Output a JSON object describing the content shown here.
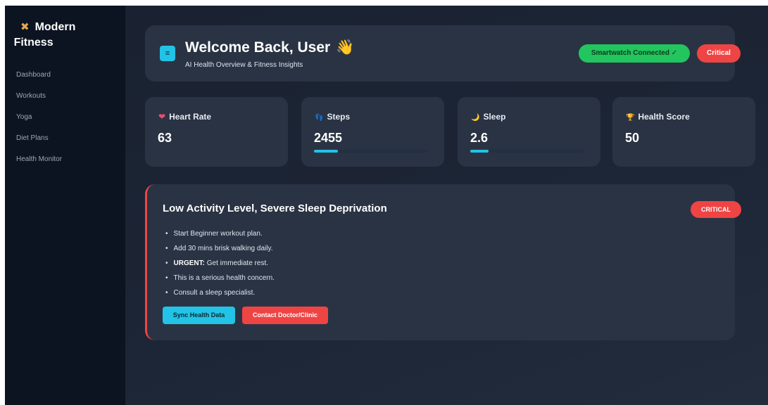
{
  "brand": {
    "icon": "dumbbell-icon",
    "line1": "Modern",
    "line2": "Fitness"
  },
  "nav": [
    {
      "label": "Dashboard"
    },
    {
      "label": "Workouts"
    },
    {
      "label": "Yoga"
    },
    {
      "label": "Diet Plans"
    },
    {
      "label": "Health Monitor"
    }
  ],
  "header": {
    "title": "Welcome Back, User",
    "wave": "👋",
    "subtitle": "AI Health Overview & Fitness Insights",
    "menu_icon": "≡",
    "device_status": "Smartwatch Connected ✓",
    "status": "Critical"
  },
  "stats": [
    {
      "label": "Heart Rate",
      "icon": "heart-icon",
      "glyph": "❤",
      "value": "63"
    },
    {
      "label": "Steps",
      "icon": "steps-icon",
      "glyph": "👣",
      "value": "2455",
      "progress": 0.21
    },
    {
      "label": "Sleep",
      "icon": "moon-icon",
      "glyph": "🌙",
      "value": "2.6",
      "progress": 0.16
    },
    {
      "label": "Health Score",
      "icon": "trophy-icon",
      "glyph": "🏆",
      "value": "50"
    }
  ],
  "alert": {
    "title": "Low Activity Level, Severe Sleep Deprivation",
    "badge": "CRITICAL",
    "recommendations": [
      {
        "text": "Start Beginner workout plan."
      },
      {
        "text": "Add 30 mins brisk walking daily."
      },
      {
        "prefix": "URGENT:",
        "text": " Get immediate rest."
      },
      {
        "text": "This is a serious health concern."
      },
      {
        "text": "Consult a sleep specialist."
      }
    ],
    "sync_label": "Sync Health Data",
    "contact_label": "Contact Doctor/Clinic"
  },
  "colors": {
    "accent": "#22c3e6",
    "danger": "#ef4444",
    "success": "#22c55e"
  }
}
